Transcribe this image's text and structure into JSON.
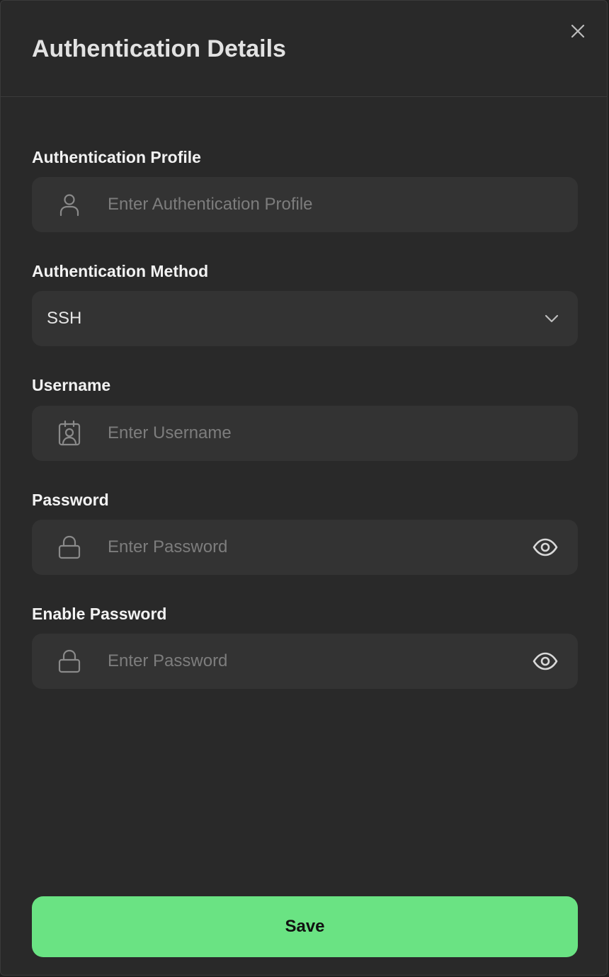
{
  "dialog": {
    "title": "Authentication Details",
    "close_icon": "close-icon"
  },
  "fields": {
    "profile": {
      "label": "Authentication Profile",
      "placeholder": "Enter Authentication Profile",
      "value": "",
      "icon": "user-icon"
    },
    "method": {
      "label": "Authentication Method",
      "selected": "SSH",
      "icon": "chevron-down-icon"
    },
    "username": {
      "label": "Username",
      "placeholder": "Enter Username",
      "value": "",
      "icon": "id-badge-icon"
    },
    "password": {
      "label": "Password",
      "placeholder": "Enter Password",
      "value": "",
      "icon": "lock-icon",
      "toggle_icon": "eye-icon"
    },
    "enable_password": {
      "label": "Enable Password",
      "placeholder": "Enter Password",
      "value": "",
      "icon": "lock-icon",
      "toggle_icon": "eye-icon"
    }
  },
  "actions": {
    "save_label": "Save"
  },
  "colors": {
    "background": "#292929",
    "field_bg": "#333333",
    "accent": "#6ae383",
    "label": "#f2f2f2",
    "placeholder": "#7d7d7d"
  }
}
